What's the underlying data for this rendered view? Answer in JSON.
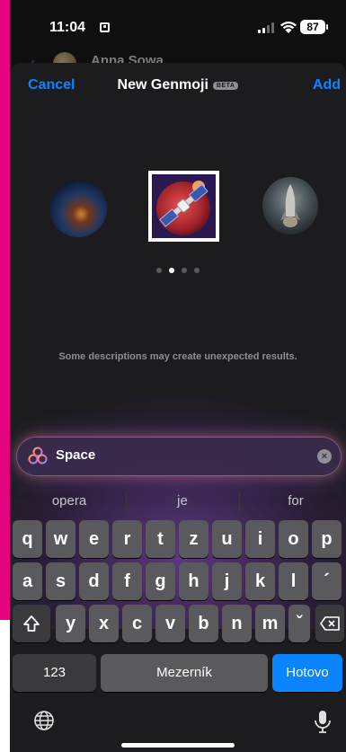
{
  "status_bar": {
    "time": "11:04",
    "battery": "87"
  },
  "background_chat": {
    "contact_name": "Anna Sowa"
  },
  "sheet": {
    "cancel_label": "Cancel",
    "title": "New Genmoji",
    "beta_badge": "BETA",
    "add_label": "Add",
    "disclaimer": "Some descriptions may create unexpected results."
  },
  "carousel": {
    "page_count": 4,
    "active_index": 1,
    "items": [
      "galaxy-emoji",
      "satellite-emoji",
      "rocket-emoji"
    ]
  },
  "prompt": {
    "value": "Space"
  },
  "suggestions": [
    "opera",
    "je",
    "for"
  ],
  "keyboard": {
    "row1": [
      "q",
      "w",
      "e",
      "r",
      "t",
      "z",
      "u",
      "i",
      "o",
      "p"
    ],
    "row2": [
      "a",
      "s",
      "d",
      "f",
      "g",
      "h",
      "j",
      "k",
      "l",
      "´"
    ],
    "row3": [
      "y",
      "x",
      "c",
      "v",
      "b",
      "n",
      "m",
      "ˇ"
    ],
    "numbers_label": "123",
    "space_label": "Mezerník",
    "done_label": "Hotovo"
  },
  "colors": {
    "accent": "#0a84ff",
    "frame": "#e5067f",
    "sheet_bg": "#1c1c1e",
    "key_bg": "#5a5a5e"
  }
}
